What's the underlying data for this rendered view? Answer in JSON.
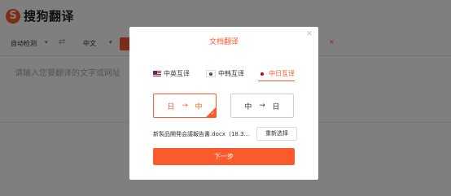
{
  "app": {
    "logo_letter": "S",
    "logo_text": "搜狗翻译",
    "brand_color": "#fb5a2c"
  },
  "toolbar": {
    "source_language": "自动检测",
    "swap_icon": "⇄",
    "target_language": "中文",
    "document_tab_close": "×"
  },
  "editor": {
    "placeholder": "请输入您要翻译的文字或网址"
  },
  "modal": {
    "title": "文档翻译",
    "close": "×",
    "tabs": [
      {
        "label": "中英互译",
        "flag": "us-flag-icon",
        "active": false
      },
      {
        "label": "中韩互译",
        "flag": "kr-flag-icon",
        "active": false
      },
      {
        "label": "中日互译",
        "flag": "jp-flag-icon",
        "active": true
      }
    ],
    "directions": [
      {
        "from": "日",
        "arrow": "→",
        "to": "中",
        "selected": true
      },
      {
        "from": "中",
        "arrow": "→",
        "to": "日",
        "selected": false
      }
    ],
    "check": "✓",
    "file_name": "新製品開発会議報告書.docx（18.3...",
    "reselect_label": "重新选择",
    "next_label": "下一步"
  }
}
